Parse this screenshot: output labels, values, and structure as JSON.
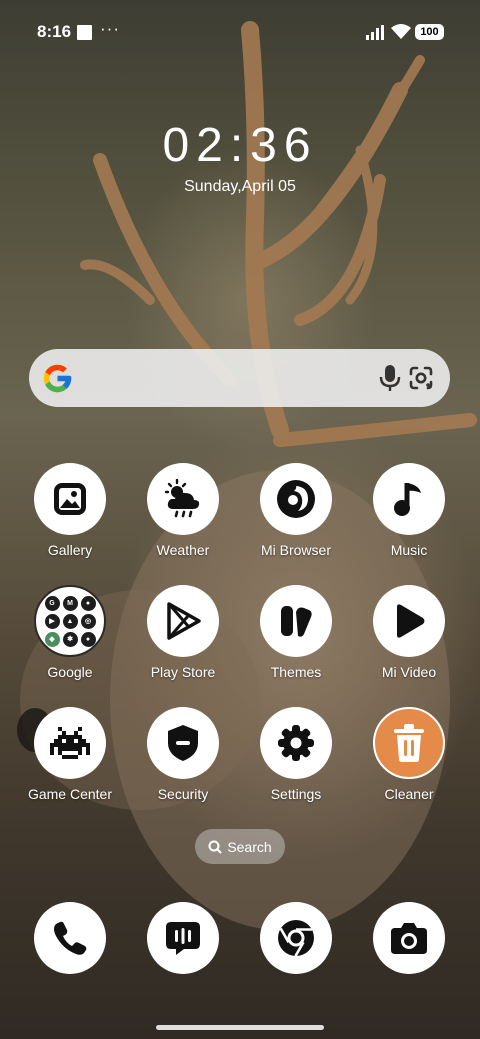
{
  "status_bar": {
    "time": "8:16",
    "more": "···",
    "battery": "100"
  },
  "clock": {
    "time": "02:36",
    "date": "Sunday,April 05"
  },
  "search_bar": {
    "mic": "mic-icon",
    "lens": "google-lens-icon"
  },
  "apps": [
    {
      "label": "Gallery",
      "icon": "gallery-icon"
    },
    {
      "label": "Weather",
      "icon": "weather-icon"
    },
    {
      "label": "Mi Browser",
      "icon": "browser-icon"
    },
    {
      "label": "Music",
      "icon": "music-icon"
    },
    {
      "label": "Google",
      "icon": "google-folder-icon"
    },
    {
      "label": "Play Store",
      "icon": "play-store-icon"
    },
    {
      "label": "Themes",
      "icon": "themes-icon"
    },
    {
      "label": "Mi Video",
      "icon": "video-play-icon"
    },
    {
      "label": "Game Center",
      "icon": "game-center-icon"
    },
    {
      "label": "Security",
      "icon": "security-shield-icon"
    },
    {
      "label": "Settings",
      "icon": "gear-icon"
    },
    {
      "label": "Cleaner",
      "icon": "trash-icon"
    }
  ],
  "app_search": {
    "label": "Search"
  },
  "dock": [
    "phone-icon",
    "messages-icon",
    "chrome-icon",
    "camera-icon"
  ]
}
